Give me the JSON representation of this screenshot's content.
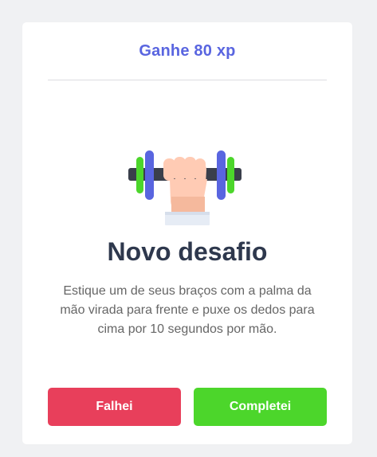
{
  "challenge": {
    "xp_label": "Ganhe 80 xp",
    "title": "Novo desafio",
    "description": "Estique um de seus braços com a palma da mão virada para frente e puxe os dedos para cima por 10 segundos por mão.",
    "icon": "dumbbell-hand-icon"
  },
  "actions": {
    "failed_label": "Falhei",
    "completed_label": "Completei"
  },
  "colors": {
    "accent": "#5965e0",
    "fail": "#e83f5b",
    "success": "#4cd62b",
    "title": "#2e384d",
    "text": "#666666"
  }
}
